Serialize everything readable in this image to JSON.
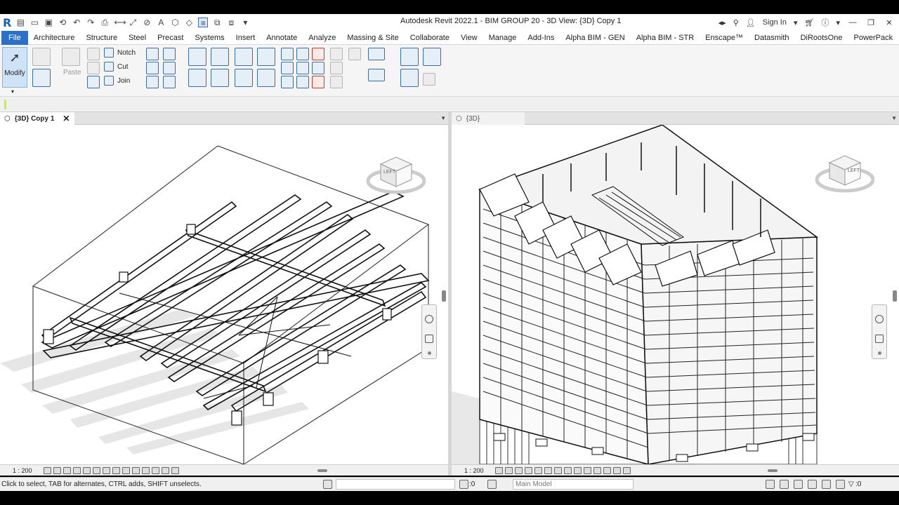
{
  "app": {
    "title": "Autodesk Revit 2022.1 - BIM GROUP 20 - 3D View: {3D} Copy 1",
    "logo": "R",
    "sign_in": "Sign In"
  },
  "menu": {
    "tabs": [
      "File",
      "Architecture",
      "Structure",
      "Steel",
      "Precast",
      "Systems",
      "Insert",
      "Annotate",
      "Analyze",
      "Massing & Site",
      "Collaborate",
      "View",
      "Manage",
      "Add-Ins",
      "Alpha BIM - GEN",
      "Alpha BIM - STR",
      "Enscape™",
      "Datasmith",
      "DiRootsOne",
      "PowerPack"
    ]
  },
  "ribbon": {
    "modify_label": "Modify",
    "paste_label": "Paste",
    "notch_label": "Notch",
    "cut_label": "Cut",
    "join_label": "Join"
  },
  "views": {
    "left": {
      "tab_label": "{3D} Copy 1",
      "scale": "1 : 200",
      "cube_label": "LEFT"
    },
    "right": {
      "tab_label": "{3D}",
      "scale": "1 : 200",
      "cube_label": "LEFT"
    }
  },
  "status": {
    "hint": "Click to select, TAB for alternates, CTRL adds, SHIFT unselects.",
    "selection_count": ":0",
    "workset": "Main Model",
    "filter_count": ":0"
  },
  "colors": {
    "file_tab": "#2a6fc9",
    "modify_active": "#cfe3f6",
    "model_lines": "#1a1a1a",
    "shadow": "#e0e0e0"
  }
}
